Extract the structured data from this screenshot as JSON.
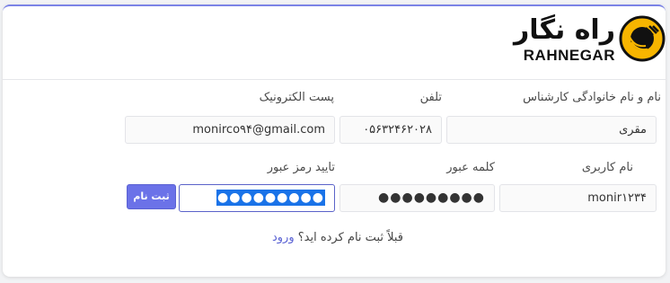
{
  "brand": {
    "name_fa": "راه نگار",
    "name_en": "RAHNEGAR",
    "accent_color": "#f7b500"
  },
  "form": {
    "fullname": {
      "label": "نام و نام خانوادگی کارشناس",
      "value": "مقری"
    },
    "phone": {
      "label": "تلفن",
      "value": "۰۵۶۳۲۴۶۲۰۲۸"
    },
    "email": {
      "label": "پست الکترونیک",
      "value": "monirco۹۴@gmail.com"
    },
    "username": {
      "label": "نام کاربری",
      "value": "monir۱۲۳۴"
    },
    "password": {
      "label": "کلمه عبور",
      "value": "●●●●●●●●●"
    },
    "password_confirm": {
      "label": "تایید رمز عبور",
      "value": "●●●●●●●●●"
    },
    "submit_label": "ثبت نام"
  },
  "footer": {
    "prompt": "قبلاً ثبت نام کرده اید؟",
    "login_link": "ورود"
  },
  "colors": {
    "primary": "#6b72e8",
    "card_top_border": "#7b83e6",
    "selection": "#1a73e8"
  }
}
